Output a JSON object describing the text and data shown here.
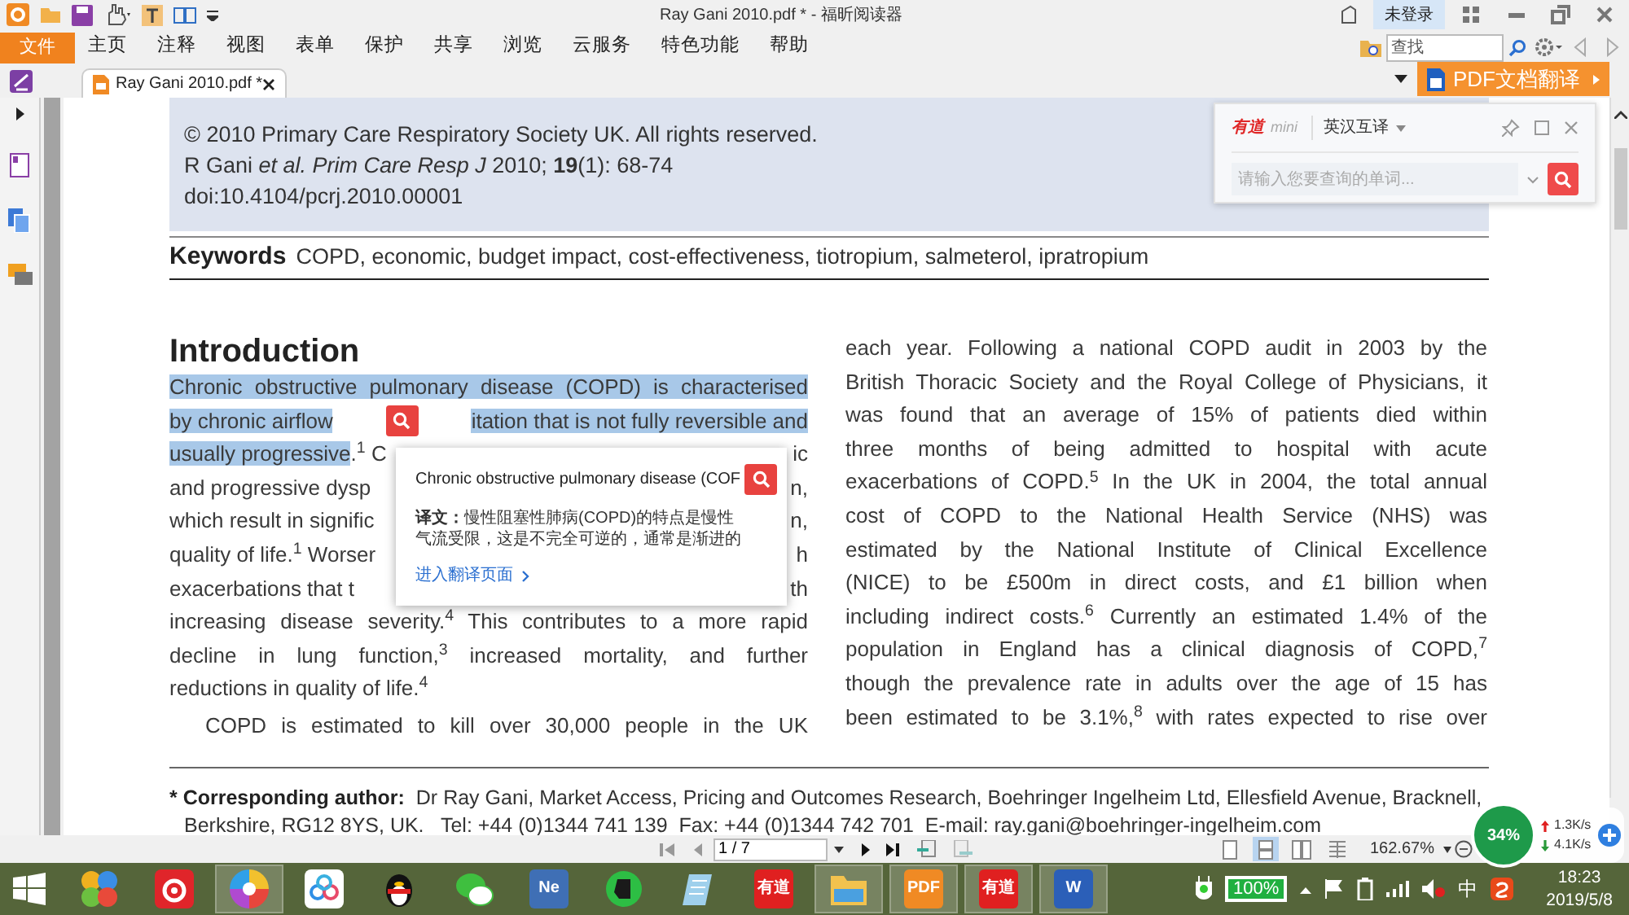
{
  "window": {
    "title": "Ray Gani 2010.pdf * - 福昕阅读器",
    "account": "未登录"
  },
  "menu": {
    "file": "文件",
    "items": [
      "主页",
      "注释",
      "视图",
      "表单",
      "保护",
      "共享",
      "浏览",
      "云服务",
      "特色功能",
      "帮助"
    ]
  },
  "search": {
    "placeholder": "查找"
  },
  "tabs": [
    {
      "label": "Ray Gani 2010.pdf *",
      "selected": true
    }
  ],
  "translate_button": "PDF文档翻译",
  "document": {
    "summary_lines": [
      "© 2010 Primary Care Respiratory Society UK. All rights reserved.",
      "R Gani *et al. Prim Care Resp J* 2010; **19**(1): 68-74",
      "doi:10.4104/pcrj.2010.00001"
    ],
    "keywords_label": "Keywords",
    "keywords": "COPD, economic, budget impact, cost-effectiveness, tiotropium, salmeterol, ipratropium",
    "heading": "Introduction",
    "left_column": [
      {
        "kind": "justify",
        "segments": [
          {
            "text": "Chronic obstructive pulmonary disease (COPD) is characterised",
            "highlighted": true
          }
        ]
      },
      {
        "kind": "lookup",
        "segments": [
          {
            "text": "by chronic airflow",
            "highlighted": true
          }
        ],
        "tail": [
          {
            "text": "itation that is not fully reversible and",
            "highlighted": true
          }
        ]
      },
      {
        "kind": "covered",
        "segments": [
          {
            "text": "usually progressive",
            "highlighted": true
          },
          {
            "text": ".$^{1}$ C",
            "highlighted": false
          }
        ],
        "tail": [
          {
            "text": "ic",
            "highlighted": false
          }
        ]
      },
      {
        "kind": "covered",
        "segments": [
          {
            "text": "and progressive dysp",
            "highlighted": false
          }
        ],
        "tail": [
          {
            "text": "n,",
            "highlighted": false
          }
        ]
      },
      {
        "kind": "covered",
        "segments": [
          {
            "text": "which result in signific",
            "highlighted": false
          }
        ],
        "tail": [
          {
            "text": "n,",
            "highlighted": false
          }
        ]
      },
      {
        "kind": "covered",
        "segments": [
          {
            "text": "quality of life.$^{1}$ Worser",
            "highlighted": false
          }
        ],
        "tail": [
          {
            "text": "h",
            "highlighted": false
          }
        ]
      },
      {
        "kind": "covered",
        "segments": [
          {
            "text": "exacerbations that t",
            "highlighted": false
          }
        ],
        "tail": [
          {
            "text": "th",
            "highlighted": false
          }
        ]
      },
      {
        "kind": "justify",
        "segments": [
          {
            "text": "increasing disease severity.$^{4}$ This contributes to a more rapid",
            "highlighted": false
          }
        ]
      },
      {
        "kind": "justify",
        "segments": [
          {
            "text": "decline in lung function,$^{3}$ increased mortality, and further",
            "highlighted": false
          }
        ]
      },
      {
        "kind": "last",
        "segments": [
          {
            "text": "reductions in quality of life.$^{4}$",
            "highlighted": false
          }
        ]
      },
      {
        "kind": "indent",
        "segments": [
          {
            "text": "COPD is estimated to kill over 30,000 people in the UK",
            "highlighted": false
          }
        ]
      }
    ],
    "right_column": [
      "each year. Following a national COPD audit in 2003 by the",
      "British Thoracic Society and the Royal College of Physicians, it",
      "was found that an average of 15% of patients died within",
      "three months of being admitted to hospital with acute",
      "exacerbations of COPD.$^{5}$ In the UK in 2004, the total annual",
      "cost of COPD to the National Health Service (NHS) was",
      "estimated by the National Institute of Clinical Excellence",
      "(NICE) to be £500m in direct costs, and £1 billion when",
      "including indirect costs.$^{6}$ Currently an estimated 1.4% of the",
      "population in England has a clinical diagnosis of COPD,$^{7}$",
      "though the prevalence rate in adults over the age of 15 has",
      "been estimated to be 3.1%,$^{8}$ with rates expected to rise over"
    ],
    "footnote": {
      "label": "* Corresponding author:",
      "lines": [
        "Dr Ray Gani, Market Access, Pricing and Outcomes Research, Boehringer Ingelheim Ltd, Ellesfield Avenue, Bracknell,",
        "Berkshire, RG12 8YS, UK.   Tel: +44 (0)1344 741 139  Fax: +44 (0)1344 742 701  E-mail: ray.gani@boehringer-ingelheim.com"
      ]
    }
  },
  "lookup_popup": {
    "query": "Chronic obstructive pulmonary disease (COF",
    "translation": "**译文：**慢性阻塞性肺病(COPD)的特点是慢性气流受限，这是不完全可逆的，通常是渐进的",
    "link": "进入翻译页面"
  },
  "dictionary_panel": {
    "logo": "有道",
    "edition": "mini",
    "mode": "英汉互译",
    "placeholder": "请输入您要查询的单词..."
  },
  "status_bar": {
    "page": "1 / 7",
    "zoom": "162.67%",
    "view_modes": [
      {
        "kind": "single",
        "selected": false
      },
      {
        "kind": "continuous",
        "selected": true
      },
      {
        "kind": "facing",
        "selected": false
      },
      {
        "kind": "cover",
        "selected": false
      }
    ]
  },
  "net_widget": {
    "percent": "34%",
    "upload": "1.3K/s",
    "download": "4.1K/s"
  },
  "taskbar": {
    "apps": [
      {
        "kind": "balls",
        "running": false
      },
      {
        "kind": "music",
        "running": false
      },
      {
        "kind": "pinwheel",
        "running": true
      },
      {
        "kind": "cloud",
        "running": false
      },
      {
        "kind": "penguin",
        "running": false
      },
      {
        "kind": "chat",
        "running": false
      },
      {
        "kind": "logo",
        "label": "Ne",
        "color": "#3f6fb5",
        "running": false
      },
      {
        "kind": "elephant",
        "running": false
      },
      {
        "kind": "notepad",
        "running": false
      },
      {
        "kind": "logo",
        "label": "有道",
        "color": "#e02020",
        "running": false
      },
      {
        "kind": "folder",
        "running": true
      },
      {
        "kind": "logo",
        "label": "PDF",
        "color": "#f08a24",
        "running": true
      },
      {
        "kind": "logo",
        "label": "有道",
        "color": "#e02020",
        "running": true
      },
      {
        "kind": "logo",
        "label": "W",
        "color": "#2b5fb8",
        "running": true
      }
    ],
    "battery": "100%",
    "ime": "中",
    "time": "18:23",
    "date": "2019/5/8"
  }
}
